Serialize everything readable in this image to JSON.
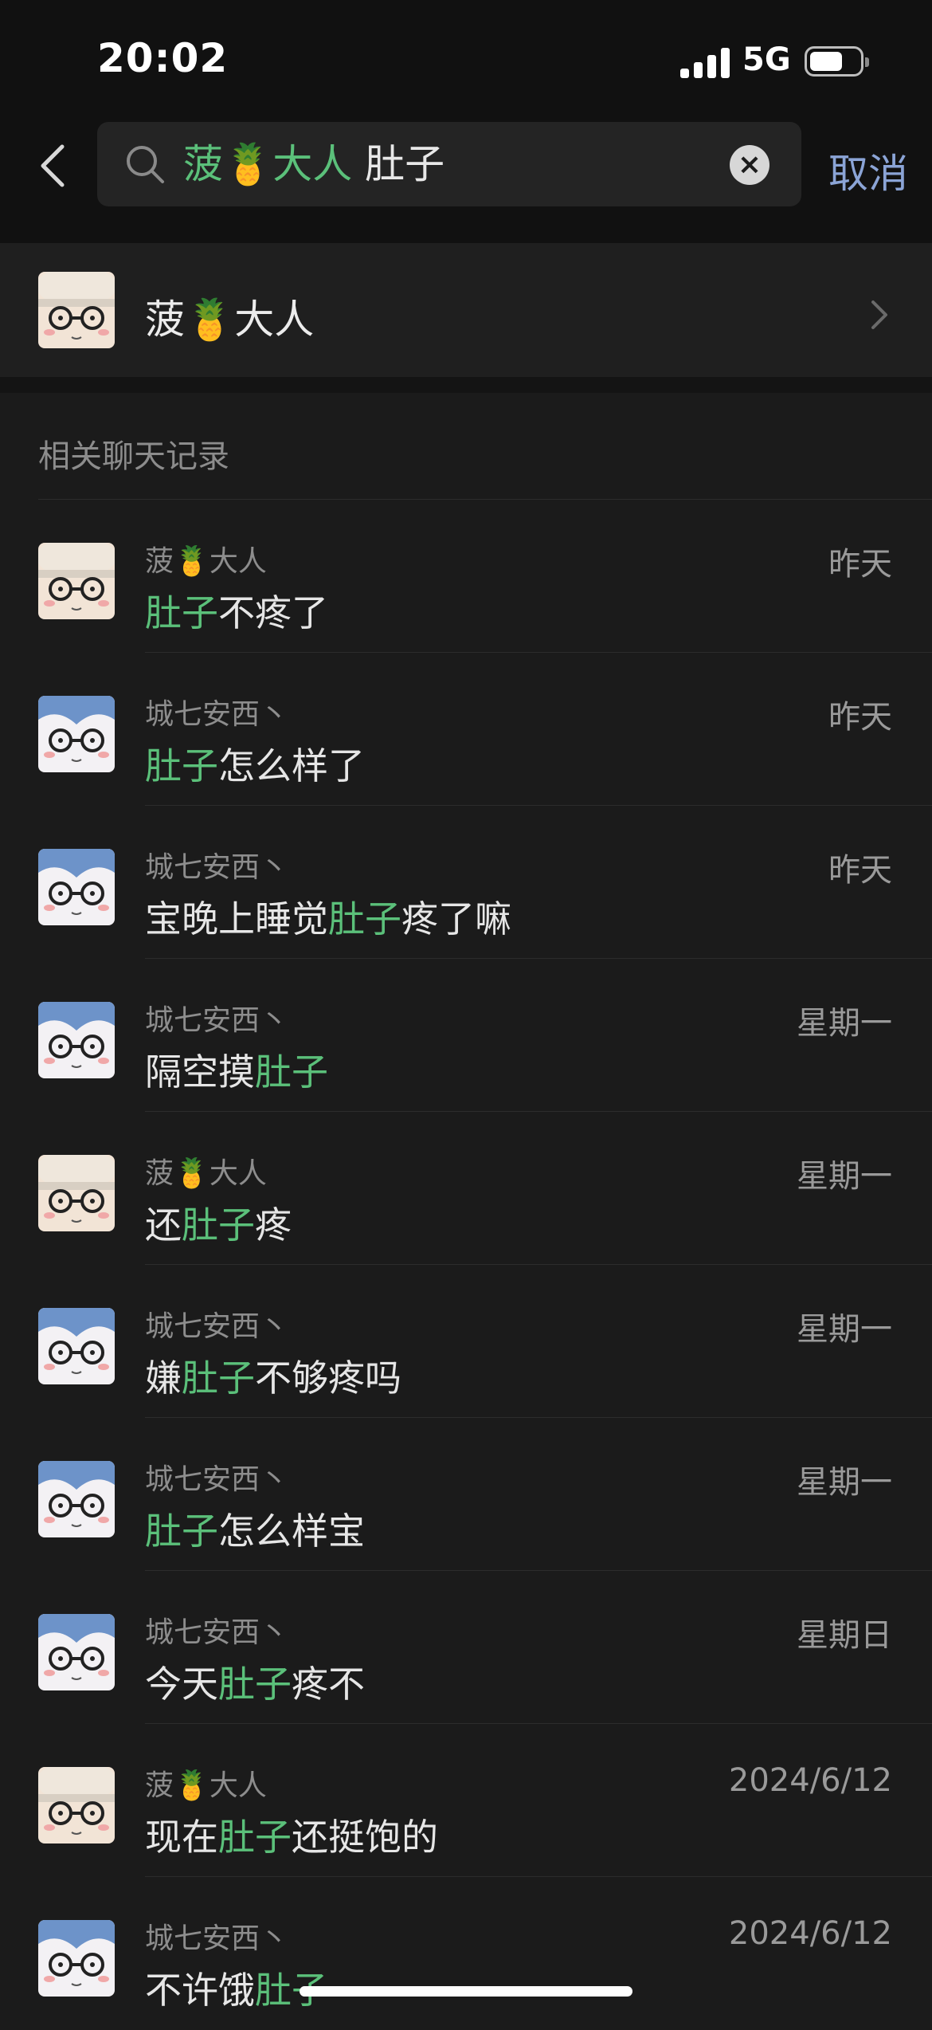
{
  "status_bar": {
    "time": "20:02",
    "network": "5G"
  },
  "search": {
    "contact_name": "菠🍍大人",
    "keyword": " 肚子",
    "cancel_label": "取消"
  },
  "contact": {
    "name": "菠🍍大人"
  },
  "section_title": "相关聊天记录",
  "results": [
    {
      "sender": "菠🍍大人",
      "time": "昨天",
      "before": "",
      "match": "肚子",
      "after": "不疼了",
      "avatar": "hat"
    },
    {
      "sender": "城七安西丶",
      "time": "昨天",
      "before": "",
      "match": "肚子",
      "after": "怎么样了",
      "avatar": "blue"
    },
    {
      "sender": "城七安西丶",
      "time": "昨天",
      "before": "宝晚上睡觉",
      "match": "肚子",
      "after": "疼了嘛",
      "avatar": "blue"
    },
    {
      "sender": "城七安西丶",
      "time": "星期一",
      "before": "隔空摸",
      "match": "肚子",
      "after": "",
      "avatar": "blue"
    },
    {
      "sender": "菠🍍大人",
      "time": "星期一",
      "before": "还",
      "match": "肚子",
      "after": "疼",
      "avatar": "hat"
    },
    {
      "sender": "城七安西丶",
      "time": "星期一",
      "before": "嫌",
      "match": "肚子",
      "after": "不够疼吗",
      "avatar": "blue"
    },
    {
      "sender": "城七安西丶",
      "time": "星期一",
      "before": "",
      "match": "肚子",
      "after": "怎么样宝",
      "avatar": "blue"
    },
    {
      "sender": "城七安西丶",
      "time": "星期日",
      "before": "今天",
      "match": "肚子",
      "after": "疼不",
      "avatar": "blue"
    },
    {
      "sender": "菠🍍大人",
      "time": "2024/6/12",
      "before": "现在",
      "match": "肚子",
      "after": "还挺饱的",
      "avatar": "hat"
    },
    {
      "sender": "城七安西丶",
      "time": "2024/6/12",
      "before": "不许饿",
      "match": "肚子",
      "after": "",
      "avatar": "blue"
    }
  ],
  "colors": {
    "highlight": "#5bc07a",
    "cancel": "#8ba4d6",
    "background": "#1b1b1b"
  }
}
